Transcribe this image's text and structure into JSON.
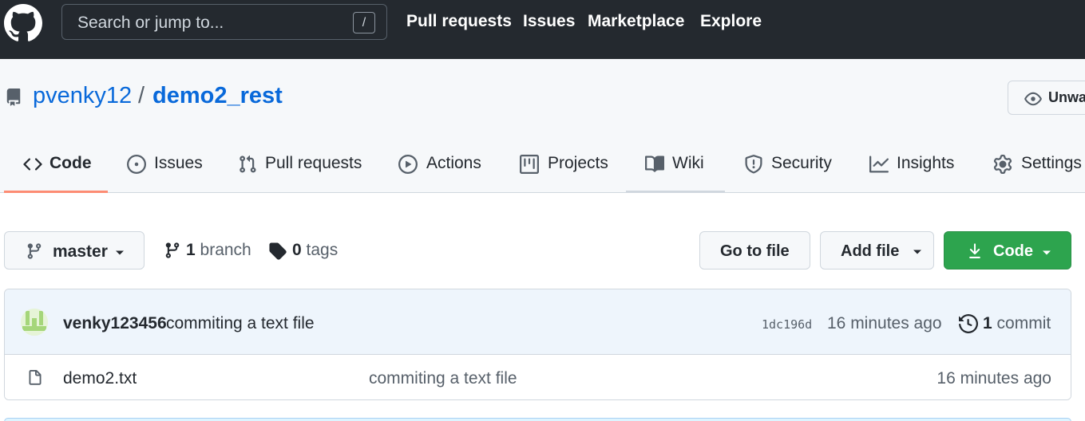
{
  "header": {
    "search_placeholder": "Search or jump to...",
    "search_shortcut": "/",
    "nav": [
      "Pull requests",
      "Issues",
      "Marketplace",
      "Explore"
    ]
  },
  "repo": {
    "owner": "pvenky12",
    "separator": "/",
    "name": "demo2_rest",
    "watch_label": "Unwatch"
  },
  "tabs": [
    {
      "label": "Code",
      "icon": "code-icon",
      "selected": true
    },
    {
      "label": "Issues",
      "icon": "issue-opened-icon"
    },
    {
      "label": "Pull requests",
      "icon": "git-pull-request-icon"
    },
    {
      "label": "Actions",
      "icon": "play-icon"
    },
    {
      "label": "Projects",
      "icon": "project-icon"
    },
    {
      "label": "Wiki",
      "icon": "book-icon"
    },
    {
      "label": "Security",
      "icon": "shield-icon"
    },
    {
      "label": "Insights",
      "icon": "graph-icon"
    },
    {
      "label": "Settings",
      "icon": "gear-icon"
    }
  ],
  "branchbar": {
    "branch": "master",
    "branch_count": "1",
    "branch_word": "branch",
    "tag_count": "0",
    "tag_word": "tags",
    "go_to_file": "Go to file",
    "add_file": "Add file",
    "code": "Code"
  },
  "commit": {
    "author": "venky123456",
    "message": "commiting a text file",
    "sha": "1dc196d",
    "time": "16 minutes ago",
    "count": "1",
    "count_word": "commit"
  },
  "files": [
    {
      "name": "demo2.txt",
      "message": "commiting a text file",
      "time": "16 minutes ago"
    }
  ],
  "colors": {
    "header_bg": "#24292f",
    "link": "#0969da",
    "green_button": "#2da44e",
    "selected_tab_underline": "#fd8c73",
    "commit_row_bg": "#eef5fc"
  }
}
